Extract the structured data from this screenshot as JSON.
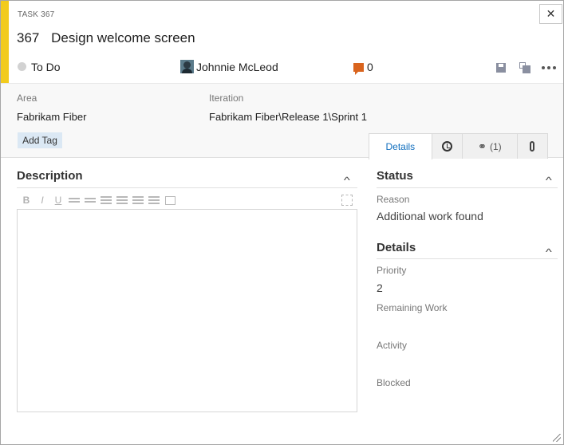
{
  "work_item": {
    "type_label": "TASK 367",
    "id": "367",
    "title": "Design welcome screen",
    "accent_color": "#f2cb1d",
    "state": "To Do",
    "assigned_to": "Johnnie McLeod",
    "comment_count": "0"
  },
  "toolbar": {
    "close_icon": "close-icon",
    "save_icon": "save-icon",
    "save_and_close_icon": "save-and-close-icon",
    "more_icon": "more-actions-icon"
  },
  "fields": {
    "area_label": "Area",
    "area_value": "Fabrikam Fiber",
    "iteration_label": "Iteration",
    "iteration_value": "Fabrikam Fiber\\Release 1\\Sprint 1",
    "add_tag_label": "Add Tag"
  },
  "tabs": [
    {
      "label": "Details",
      "active": true
    },
    {
      "icon": "history-icon"
    },
    {
      "icon": "link-icon",
      "label": "(1)"
    },
    {
      "icon": "attachment-icon"
    }
  ],
  "description": {
    "title": "Description",
    "toolbar_buttons": [
      "B",
      "I",
      "U"
    ]
  },
  "status_section": {
    "title": "Status",
    "reason_label": "Reason",
    "reason_value": "Additional work found"
  },
  "details_section": {
    "title": "Details",
    "priority_label": "Priority",
    "priority_value": "2",
    "remaining_work_label": "Remaining Work",
    "activity_label": "Activity",
    "blocked_label": "Blocked"
  },
  "colors": {
    "accent": "#f2cb1d",
    "link_blue": "#106ebe",
    "comment_orange": "#d9641e",
    "tag_bg": "#dbe8f4"
  }
}
